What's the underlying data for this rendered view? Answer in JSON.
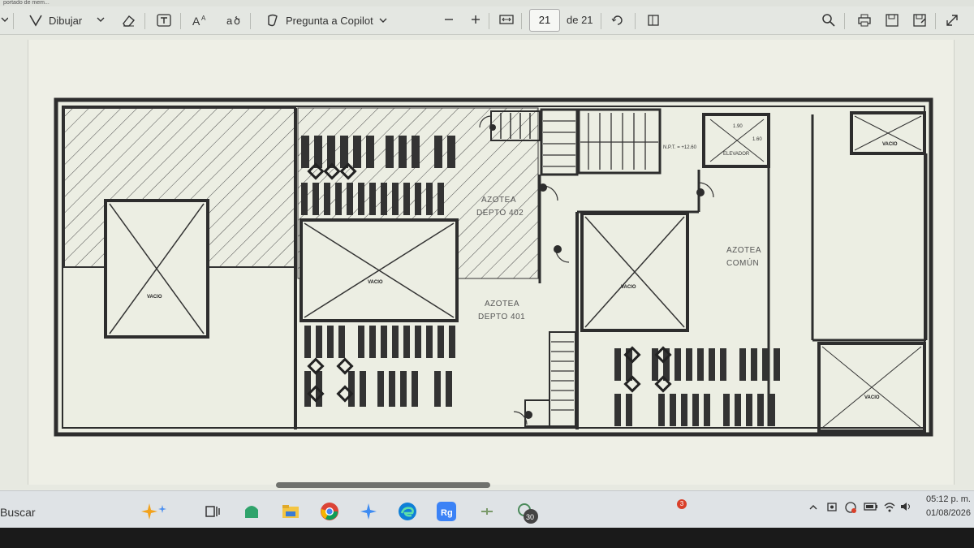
{
  "window": {
    "title_fragment": "portado de mem..."
  },
  "toolbar": {
    "draw_label": "Dibujar",
    "copilot_label": "Pregunta a Copilot",
    "page_current": "21",
    "page_total_label": "de 21"
  },
  "plan": {
    "labels": {
      "azotea_402_line1": "AZOTEA",
      "azotea_402_line2": "DEPTO 402",
      "azotea_401_line1": "AZOTEA",
      "azotea_401_line2": "DEPTO 401",
      "azotea_comun_line1": "AZOTEA",
      "azotea_comun_line2": "COMÚN",
      "vacio": "VACIO",
      "elevador": "ELEVADOR",
      "npt": "N.P.T. = +12.60",
      "dim_190": "1.90",
      "dim_160": "1.60"
    }
  },
  "taskbar": {
    "search_label": "Buscar",
    "notification_badge": "3",
    "app_badge": "30",
    "time": "05:12 p. m.",
    "date": "01/08/2026"
  }
}
